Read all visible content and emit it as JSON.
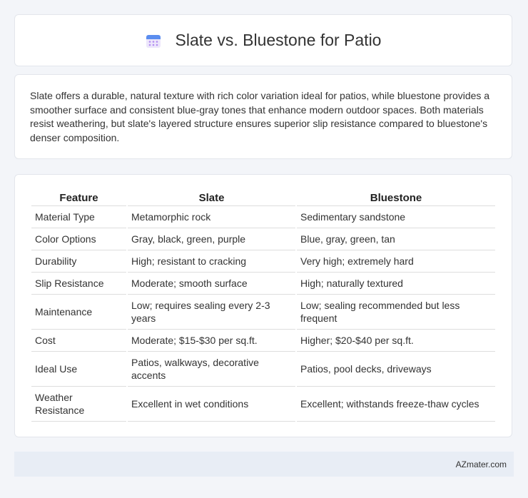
{
  "header": {
    "title": "Slate vs. Bluestone for Patio",
    "icon": "calendar-icon"
  },
  "summary": {
    "text": "Slate offers a durable, natural texture with rich color variation ideal for patios, while bluestone provides a smoother surface and consistent blue-gray tones that enhance modern outdoor spaces. Both materials resist weathering, but slate's layered structure ensures superior slip resistance compared to bluestone's denser composition."
  },
  "table": {
    "headers": [
      "Feature",
      "Slate",
      "Bluestone"
    ],
    "rows": [
      [
        "Material Type",
        "Metamorphic rock",
        "Sedimentary sandstone"
      ],
      [
        "Color Options",
        "Gray, black, green, purple",
        "Blue, gray, green, tan"
      ],
      [
        "Durability",
        "High; resistant to cracking",
        "Very high; extremely hard"
      ],
      [
        "Slip Resistance",
        "Moderate; smooth surface",
        "High; naturally textured"
      ],
      [
        "Maintenance",
        "Low; requires sealing every 2-3 years",
        "Low; sealing recommended but less frequent"
      ],
      [
        "Cost",
        "Moderate; $15-$30 per sq.ft.",
        "Higher; $20-$40 per sq.ft."
      ],
      [
        "Ideal Use",
        "Patios, walkways, decorative accents",
        "Patios, pool decks, driveways"
      ],
      [
        "Weather Resistance",
        "Excellent in wet conditions",
        "Excellent; withstands freeze-thaw cycles"
      ]
    ]
  },
  "footer": {
    "brand": "AZmater.com"
  },
  "colors": {
    "page_bg": "#f3f5f9",
    "footer_bg": "#e8edf5",
    "icon_blue": "#5b8def",
    "icon_purple": "#b38df0"
  }
}
